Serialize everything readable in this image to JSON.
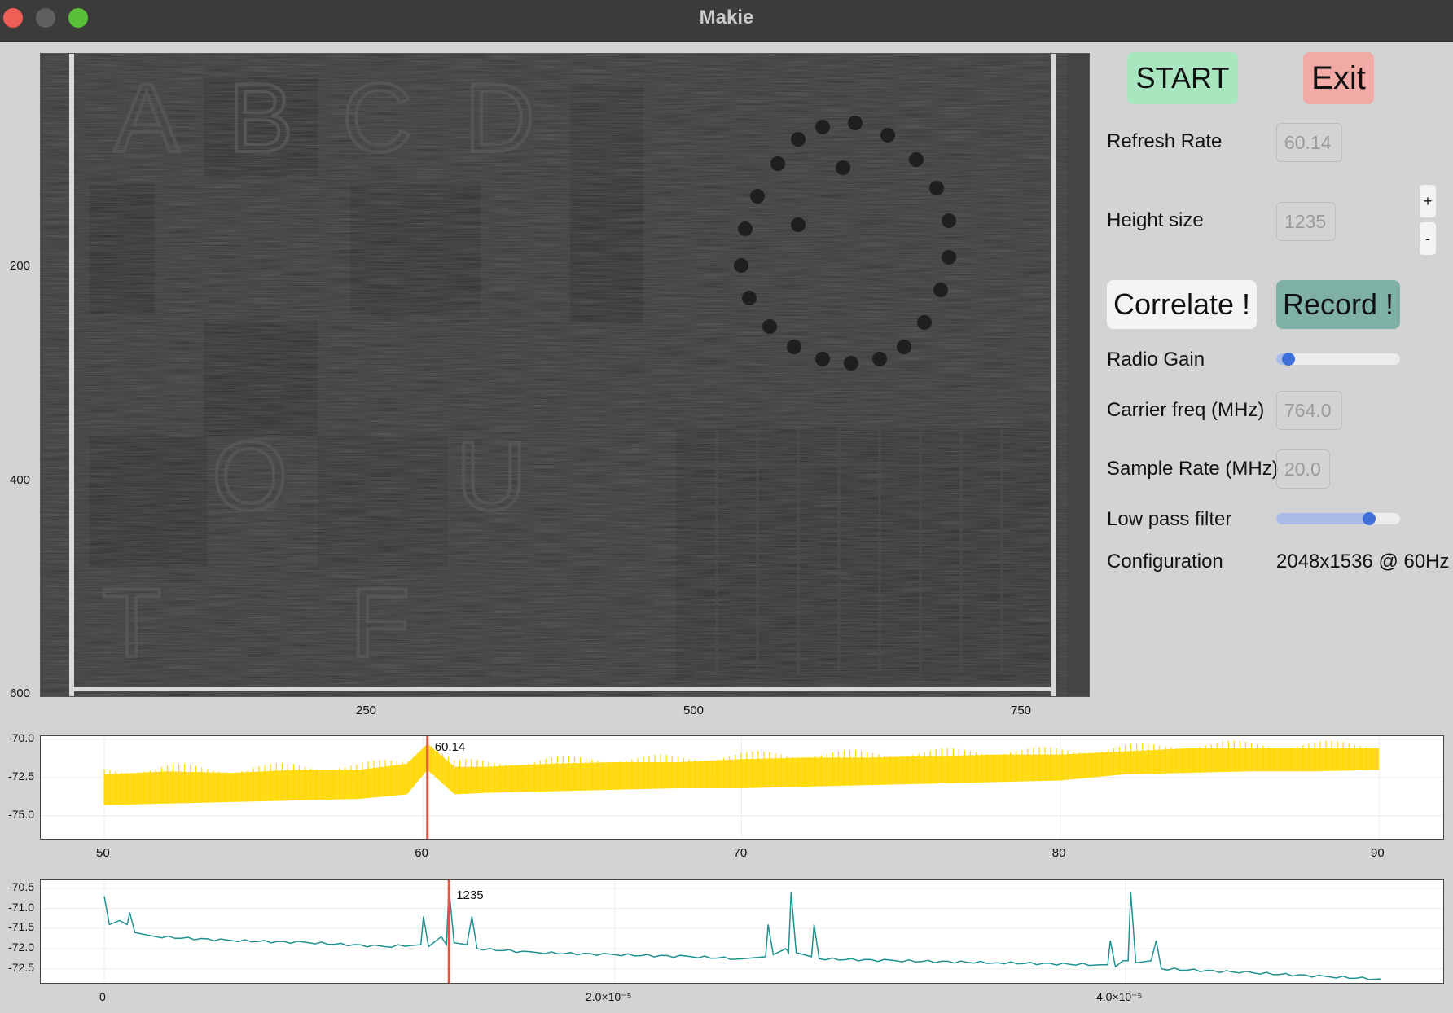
{
  "window": {
    "title": "Makie"
  },
  "heatmap": {
    "y_ticks": [
      "200",
      "400",
      "600"
    ],
    "x_ticks": [
      "250",
      "500",
      "750"
    ],
    "overlay_letters": [
      "A",
      "B",
      "C",
      "D",
      "O",
      "U",
      "T",
      "F"
    ]
  },
  "controls": {
    "start_label": "START",
    "exit_label": "Exit",
    "refresh_rate_label": "Refresh Rate",
    "refresh_rate_value": "60.14",
    "height_size_label": "Height size",
    "height_size_value": "1235",
    "plus_label": "+",
    "minus_label": "-",
    "correlate_label": "Correlate !",
    "record_label": "Record !",
    "radio_gain_label": "Radio Gain",
    "radio_gain_level": 0.05,
    "carrier_freq_label": "Carrier freq (MHz)",
    "carrier_freq_value": "764.0",
    "sample_rate_label": "Sample Rate (MHz)",
    "sample_rate_value": "20.0",
    "low_pass_label": "Low pass filter",
    "low_pass_level": 0.78,
    "configuration_label": "Configuration",
    "configuration_value": "2048x1536 @ 60Hz"
  },
  "colors": {
    "start_bg": "#a8e6bf",
    "exit_bg": "#f1aaa6",
    "correlate_bg": "#f4f4f4",
    "record_bg": "#7fb0a5",
    "spectrum1": "#ffd700",
    "spectrum2": "#1f9190",
    "marker": "#e8533f"
  },
  "chart_data": [
    {
      "type": "line",
      "series_color": "#ffd700",
      "xlim": [
        50,
        90
      ],
      "ylim": [
        -76.5,
        -69.8
      ],
      "x_ticks": [
        "50",
        "60",
        "70",
        "80",
        "90"
      ],
      "y_ticks": [
        "-70.0",
        "-72.5",
        "-75.0"
      ],
      "marker": {
        "x": 60.14,
        "label": "60.14"
      },
      "envelope": {
        "x": [
          50,
          52,
          54,
          56,
          58,
          59.5,
          60.14,
          61,
          62,
          64,
          66,
          68,
          70,
          72,
          74,
          76,
          78,
          80,
          82,
          84,
          86,
          88,
          90
        ],
        "upper": [
          -72.3,
          -72.1,
          -72.2,
          -72.0,
          -72.0,
          -71.6,
          -70.3,
          -71.8,
          -71.8,
          -71.6,
          -71.5,
          -71.5,
          -71.3,
          -71.2,
          -71.2,
          -71.1,
          -71.0,
          -71.0,
          -70.8,
          -70.6,
          -70.6,
          -70.6,
          -70.6
        ],
        "lower": [
          -74.3,
          -74.2,
          -74.1,
          -74.0,
          -73.9,
          -73.6,
          -72.0,
          -73.6,
          -73.5,
          -73.4,
          -73.3,
          -73.2,
          -73.2,
          -73.1,
          -73.0,
          -72.9,
          -72.8,
          -72.7,
          -72.3,
          -72.2,
          -72.1,
          -72.1,
          -72.0
        ]
      }
    },
    {
      "type": "line",
      "series_color": "#1f9190",
      "xlim": [
        -2.5e-06,
        5.245e-05
      ],
      "ylim": [
        -72.85,
        -70.3
      ],
      "x_ticks": [
        "0",
        "2.0×10⁻⁵",
        "4.0×10⁻⁵"
      ],
      "x_tick_values": [
        0,
        2e-05,
        4e-05
      ],
      "y_ticks": [
        "-70.5",
        "-71.0",
        "-71.5",
        "-72.0",
        "-72.5"
      ],
      "y_tick_values": [
        -70.5,
        -71.0,
        -71.5,
        -72.0,
        -72.5
      ],
      "marker": {
        "x": 1.35e-05,
        "label": "1235"
      },
      "points": [
        [
          0,
          -70.7
        ],
        [
          2e-07,
          -71.4
        ],
        [
          6e-07,
          -71.3
        ],
        [
          9e-07,
          -71.4
        ],
        [
          1e-06,
          -71.1
        ],
        [
          1.2e-06,
          -71.6
        ],
        [
          2e-06,
          -71.7
        ],
        [
          5e-06,
          -71.8
        ],
        [
          8e-06,
          -71.85
        ],
        [
          1.1e-05,
          -71.95
        ],
        [
          1.24e-05,
          -71.9
        ],
        [
          1.25e-05,
          -71.2
        ],
        [
          1.27e-05,
          -71.95
        ],
        [
          1.32e-05,
          -71.7
        ],
        [
          1.34e-05,
          -71.9
        ],
        [
          1.35e-05,
          -70.5
        ],
        [
          1.37e-05,
          -71.85
        ],
        [
          1.42e-05,
          -71.9
        ],
        [
          1.44e-05,
          -71.2
        ],
        [
          1.46e-05,
          -72.0
        ],
        [
          1.7e-05,
          -72.1
        ],
        [
          2e-05,
          -72.15
        ],
        [
          2.3e-05,
          -72.2
        ],
        [
          2.5e-05,
          -72.25
        ],
        [
          2.59e-05,
          -72.2
        ],
        [
          2.6e-05,
          -71.4
        ],
        [
          2.62e-05,
          -72.15
        ],
        [
          2.67e-05,
          -72.0
        ],
        [
          2.68e-05,
          -72.1
        ],
        [
          2.69e-05,
          -70.6
        ],
        [
          2.71e-05,
          -72.1
        ],
        [
          2.77e-05,
          -72.2
        ],
        [
          2.78e-05,
          -71.4
        ],
        [
          2.8e-05,
          -72.25
        ],
        [
          3.1e-05,
          -72.3
        ],
        [
          3.5e-05,
          -72.35
        ],
        [
          3.9e-05,
          -72.4
        ],
        [
          3.93e-05,
          -72.4
        ],
        [
          3.94e-05,
          -71.8
        ],
        [
          3.96e-05,
          -72.45
        ],
        [
          3.99e-05,
          -72.3
        ],
        [
          4.01e-05,
          -72.3
        ],
        [
          4.02e-05,
          -70.6
        ],
        [
          4.04e-05,
          -72.35
        ],
        [
          4.1e-05,
          -72.3
        ],
        [
          4.12e-05,
          -71.8
        ],
        [
          4.14e-05,
          -72.5
        ],
        [
          4.5e-05,
          -72.6
        ],
        [
          4.8e-05,
          -72.7
        ],
        [
          5e-05,
          -72.75
        ]
      ]
    }
  ]
}
